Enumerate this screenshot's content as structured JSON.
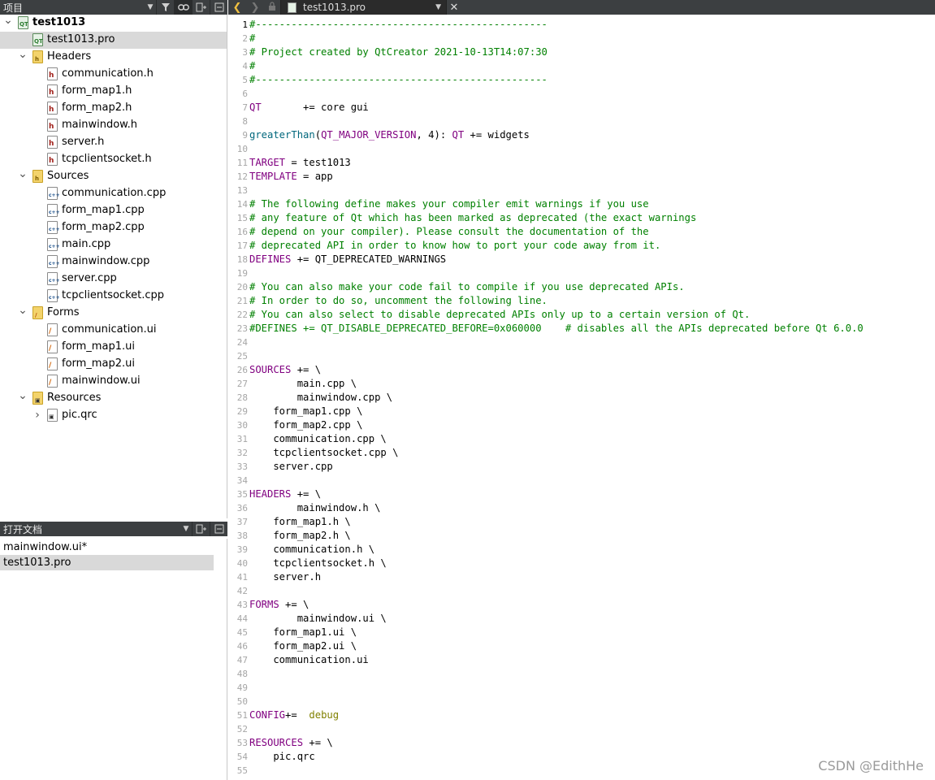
{
  "project_pane": {
    "title": "项目",
    "filter_icon": "filter-icon",
    "link_icon": "link-icon",
    "split_icon": "split-icon",
    "close_icon": "close-pane-icon"
  },
  "tree": [
    {
      "label": "test1013",
      "level": 0,
      "expanded": true,
      "icon": "project-icon",
      "bold": true
    },
    {
      "label": "test1013.pro",
      "level": 1,
      "icon": "pro-file-icon",
      "selected": true
    },
    {
      "label": "Headers",
      "level": 1,
      "expanded": true,
      "icon": "folder-icon"
    },
    {
      "label": "communication.h",
      "level": 2,
      "icon": "header-file-icon"
    },
    {
      "label": "form_map1.h",
      "level": 2,
      "icon": "header-file-icon"
    },
    {
      "label": "form_map2.h",
      "level": 2,
      "icon": "header-file-icon"
    },
    {
      "label": "mainwindow.h",
      "level": 2,
      "icon": "header-file-icon"
    },
    {
      "label": "server.h",
      "level": 2,
      "icon": "header-file-icon"
    },
    {
      "label": "tcpclientsocket.h",
      "level": 2,
      "icon": "header-file-icon"
    },
    {
      "label": "Sources",
      "level": 1,
      "expanded": true,
      "icon": "folder-icon"
    },
    {
      "label": "communication.cpp",
      "level": 2,
      "icon": "cpp-file-icon"
    },
    {
      "label": "form_map1.cpp",
      "level": 2,
      "icon": "cpp-file-icon"
    },
    {
      "label": "form_map2.cpp",
      "level": 2,
      "icon": "cpp-file-icon"
    },
    {
      "label": "main.cpp",
      "level": 2,
      "icon": "cpp-file-icon"
    },
    {
      "label": "mainwindow.cpp",
      "level": 2,
      "icon": "cpp-file-icon"
    },
    {
      "label": "server.cpp",
      "level": 2,
      "icon": "cpp-file-icon"
    },
    {
      "label": "tcpclientsocket.cpp",
      "level": 2,
      "icon": "cpp-file-icon"
    },
    {
      "label": "Forms",
      "level": 1,
      "expanded": true,
      "icon": "forms-folder-icon"
    },
    {
      "label": "communication.ui",
      "level": 2,
      "icon": "ui-file-icon"
    },
    {
      "label": "form_map1.ui",
      "level": 2,
      "icon": "ui-file-icon"
    },
    {
      "label": "form_map2.ui",
      "level": 2,
      "icon": "ui-file-icon"
    },
    {
      "label": "mainwindow.ui",
      "level": 2,
      "icon": "ui-file-icon"
    },
    {
      "label": "Resources",
      "level": 1,
      "expanded": true,
      "icon": "resources-folder-icon"
    },
    {
      "label": "pic.qrc",
      "level": 2,
      "expanded": false,
      "icon": "qrc-file-icon"
    }
  ],
  "open_docs": {
    "title": "打开文档",
    "items": [
      {
        "label": "mainwindow.ui*",
        "selected": false
      },
      {
        "label": "test1013.pro",
        "selected": true
      }
    ]
  },
  "editor": {
    "file_name": "test1013.pro",
    "current_line": 1,
    "lines": [
      [
        [
          "#-------------------------------------------------",
          "com"
        ]
      ],
      [
        [
          "#",
          "com"
        ]
      ],
      [
        [
          "# Project created by QtCreator 2021-10-13T14:07:30",
          "com"
        ]
      ],
      [
        [
          "#",
          "com"
        ]
      ],
      [
        [
          "#-------------------------------------------------",
          "com"
        ]
      ],
      [],
      [
        [
          "QT",
          "kw"
        ],
        [
          "       += core gui",
          "pl"
        ]
      ],
      [],
      [
        [
          "greaterThan",
          "fn"
        ],
        [
          "(",
          "pl"
        ],
        [
          "QT_MAJOR_VERSION",
          "kw"
        ],
        [
          ", 4): ",
          "pl"
        ],
        [
          "QT",
          "kw"
        ],
        [
          " += widgets",
          "pl"
        ]
      ],
      [],
      [
        [
          "TARGET",
          "kw"
        ],
        [
          " = test1013",
          "pl"
        ]
      ],
      [
        [
          "TEMPLATE",
          "kw"
        ],
        [
          " = app",
          "pl"
        ]
      ],
      [],
      [
        [
          "# The following define makes your compiler emit warnings if you use",
          "com"
        ]
      ],
      [
        [
          "# any feature of Qt which has been marked as deprecated (the exact warnings",
          "com"
        ]
      ],
      [
        [
          "# depend on your compiler). Please consult the documentation of the",
          "com"
        ]
      ],
      [
        [
          "# deprecated API in order to know how to port your code away from it.",
          "com"
        ]
      ],
      [
        [
          "DEFINES",
          "kw"
        ],
        [
          " += QT_DEPRECATED_WARNINGS",
          "pl"
        ]
      ],
      [],
      [
        [
          "# You can also make your code fail to compile if you use deprecated APIs.",
          "com"
        ]
      ],
      [
        [
          "# In order to do so, uncomment the following line.",
          "com"
        ]
      ],
      [
        [
          "# You can also select to disable deprecated APIs only up to a certain version of Qt.",
          "com"
        ]
      ],
      [
        [
          "#DEFINES += QT_DISABLE_DEPRECATED_BEFORE=0x060000    # disables all the APIs deprecated before Qt 6.0.0",
          "com"
        ]
      ],
      [],
      [],
      [
        [
          "SOURCES",
          "kw"
        ],
        [
          " += \\",
          "pl"
        ]
      ],
      [
        [
          "        main.cpp \\",
          "pl"
        ]
      ],
      [
        [
          "        mainwindow.cpp \\",
          "pl"
        ]
      ],
      [
        [
          "    form_map1.cpp \\",
          "pl"
        ]
      ],
      [
        [
          "    form_map2.cpp \\",
          "pl"
        ]
      ],
      [
        [
          "    communication.cpp \\",
          "pl"
        ]
      ],
      [
        [
          "    tcpclientsocket.cpp \\",
          "pl"
        ]
      ],
      [
        [
          "    server.cpp",
          "pl"
        ]
      ],
      [],
      [
        [
          "HEADERS",
          "kw"
        ],
        [
          " += \\",
          "pl"
        ]
      ],
      [
        [
          "        mainwindow.h \\",
          "pl"
        ]
      ],
      [
        [
          "    form_map1.h \\",
          "pl"
        ]
      ],
      [
        [
          "    form_map2.h \\",
          "pl"
        ]
      ],
      [
        [
          "    communication.h \\",
          "pl"
        ]
      ],
      [
        [
          "    tcpclientsocket.h \\",
          "pl"
        ]
      ],
      [
        [
          "    server.h",
          "pl"
        ]
      ],
      [],
      [
        [
          "FORMS",
          "kw"
        ],
        [
          " += \\",
          "pl"
        ]
      ],
      [
        [
          "        mainwindow.ui \\",
          "pl"
        ]
      ],
      [
        [
          "    form_map1.ui \\",
          "pl"
        ]
      ],
      [
        [
          "    form_map2.ui \\",
          "pl"
        ]
      ],
      [
        [
          "    communication.ui",
          "pl"
        ]
      ],
      [],
      [],
      [],
      [
        [
          "CONFIG",
          "kw"
        ],
        [
          "+=  ",
          "pl"
        ],
        [
          "debug",
          "val"
        ]
      ],
      [],
      [
        [
          "RESOURCES",
          "kw"
        ],
        [
          " += \\",
          "pl"
        ]
      ],
      [
        [
          "    pic.qrc",
          "pl"
        ]
      ],
      []
    ]
  },
  "watermark": "CSDN @EdithHe",
  "colors": {
    "comment": "#008000",
    "keyword": "#800080",
    "function": "#00677c",
    "value": "#808000",
    "toolbar_bg": "#3c3f41",
    "selection": "#d9d9d9"
  }
}
